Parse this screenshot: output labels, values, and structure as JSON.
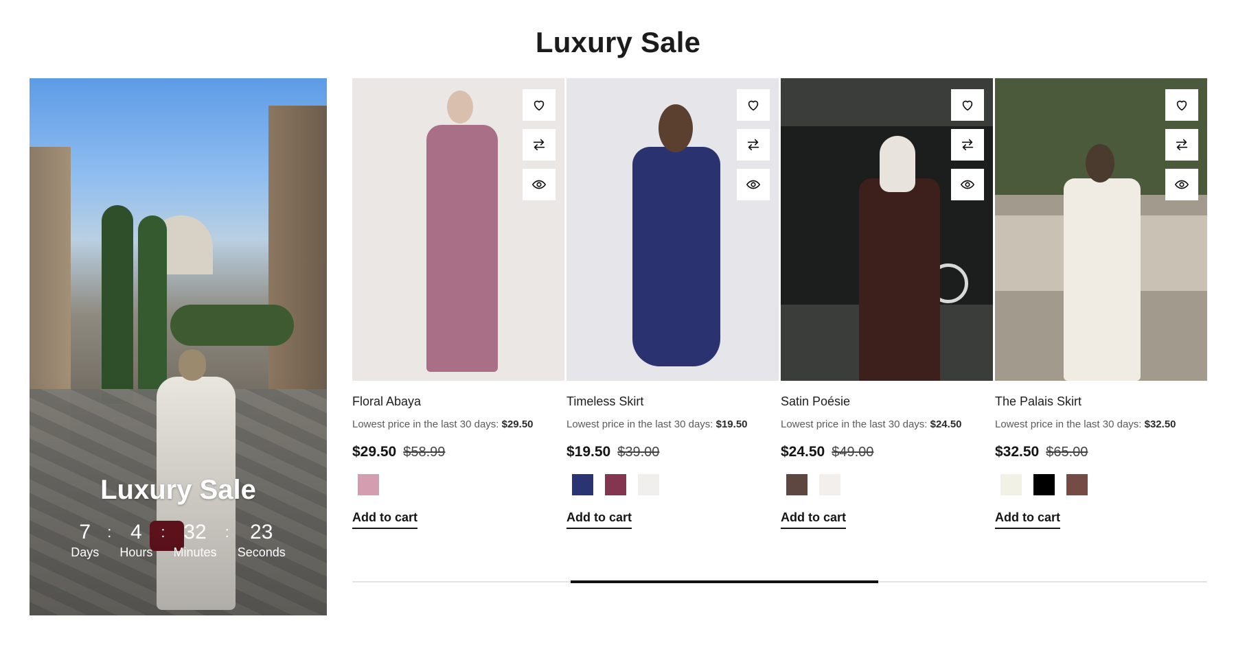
{
  "section": {
    "title": "Luxury Sale"
  },
  "promo": {
    "title": "Luxury Sale",
    "countdown": [
      {
        "value": "7",
        "label": "Days"
      },
      {
        "value": "4",
        "label": "Hours"
      },
      {
        "value": "32",
        "label": "Minutes"
      },
      {
        "value": "23",
        "label": "Seconds"
      }
    ],
    "separator": ":"
  },
  "products": [
    {
      "name": "Floral Abaya",
      "lowest_label": "Lowest price in the last 30 days:",
      "lowest_price": "$29.50",
      "price": "$29.50",
      "old_price": "$58.99",
      "swatches": [
        "#d39eaf"
      ],
      "add_to_cart": "Add to cart",
      "image": {
        "bg": "#ebe7e5",
        "garment": "#a86f87",
        "head": "#d9bfae"
      }
    },
    {
      "name": "Timeless Skirt",
      "lowest_label": "Lowest price in the last 30 days:",
      "lowest_price": "$19.50",
      "price": "$19.50",
      "old_price": "$39.00",
      "swatches": [
        "#2a3473",
        "#84354f",
        "#f1efec"
      ],
      "add_to_cart": "Add to cart",
      "image": {
        "bg": "#e6e5ea",
        "garment": "#2a3270",
        "head": "#5b3f2f"
      }
    },
    {
      "name": "Satin Poésie",
      "lowest_label": "Lowest price in the last 30 days:",
      "lowest_price": "$24.50",
      "price": "$24.50",
      "old_price": "$49.00",
      "swatches": [
        "#5e4740",
        "#f2efed"
      ],
      "add_to_cart": "Add to cart",
      "image": {
        "bg": "#3a3d3a",
        "garment": "#3d201c",
        "head": "#e8e3dc"
      }
    },
    {
      "name": "The Palais Skirt",
      "lowest_label": "Lowest price in the last 30 days:",
      "lowest_price": "$32.50",
      "price": "$32.50",
      "old_price": "$65.00",
      "swatches": [
        "#f2f1e6",
        "#000000",
        "#754b46"
      ],
      "add_to_cart": "Add to cart",
      "image": {
        "bg": "#a29a8d",
        "garment": "#f0ece3",
        "head": "#4b3a2e"
      }
    }
  ],
  "icons": {
    "wishlist": "heart-icon",
    "compare": "compare-arrows-icon",
    "quick_view": "eye-icon"
  },
  "slider": {
    "progress_fraction": 0.36
  }
}
